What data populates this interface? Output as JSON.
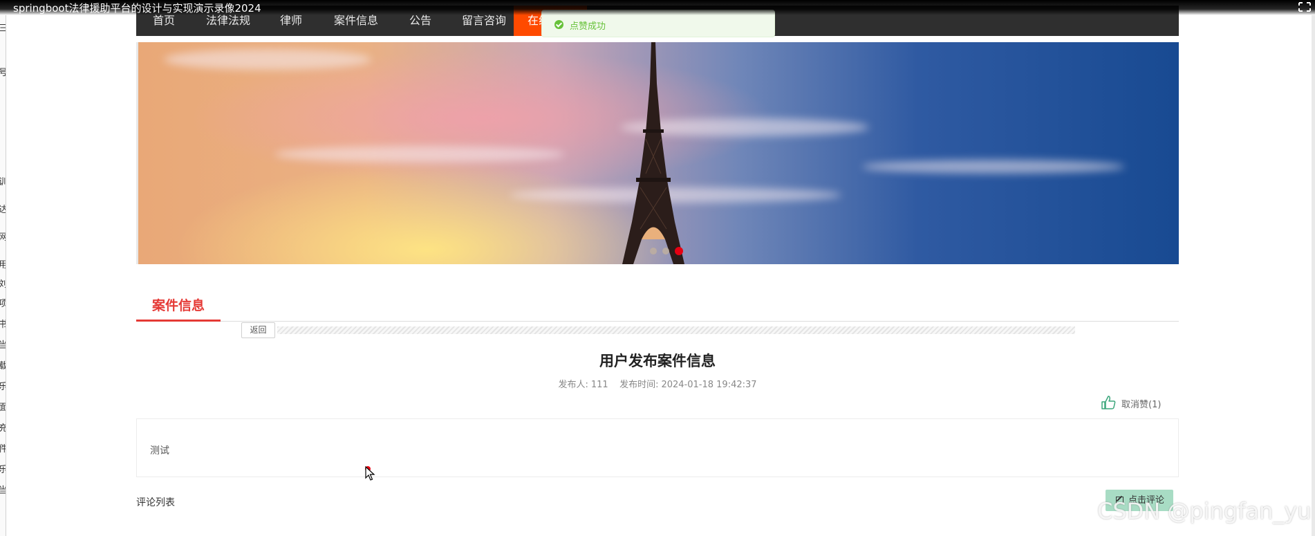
{
  "video": {
    "title": "springboot法律援助平台的设计与实现演示录像2024"
  },
  "left_window_fragments": [
    "三",
    "号",
    "训",
    "达",
    "网",
    "用",
    "刘",
    "项",
    "书",
    "当",
    "载",
    "乐",
    "面",
    "充",
    "件",
    "乐",
    "当"
  ],
  "nav": {
    "items": [
      {
        "label": "首页"
      },
      {
        "label": "法律法规"
      },
      {
        "label": "律师"
      },
      {
        "label": "案件信息"
      },
      {
        "label": "公告"
      },
      {
        "label": "留言咨询"
      },
      {
        "label": "在线"
      }
    ],
    "active_index": 6
  },
  "toast": {
    "message": "点赞成功"
  },
  "banner": {
    "slide_count": 3,
    "active_slide": 3
  },
  "section": {
    "tab_label": "案件信息"
  },
  "back_button": {
    "label": "返回"
  },
  "article": {
    "title": "用户发布案件信息",
    "publisher_label": "发布人:",
    "publisher": "111",
    "time_label": "发布时间:",
    "time": "2024-01-18 19:42:37",
    "like_label": "取消赞(1)",
    "content": "测试"
  },
  "comments": {
    "label": "评论列表",
    "button_label": "点击评论"
  },
  "watermark": "CSDN @pingfan_yu",
  "colors": {
    "nav_bg": "#2f2f2f",
    "nav_active": "#ff4a00",
    "accent_red": "#e53935",
    "toast_green": "#67c23a",
    "comment_button": "#a8dcc4"
  }
}
